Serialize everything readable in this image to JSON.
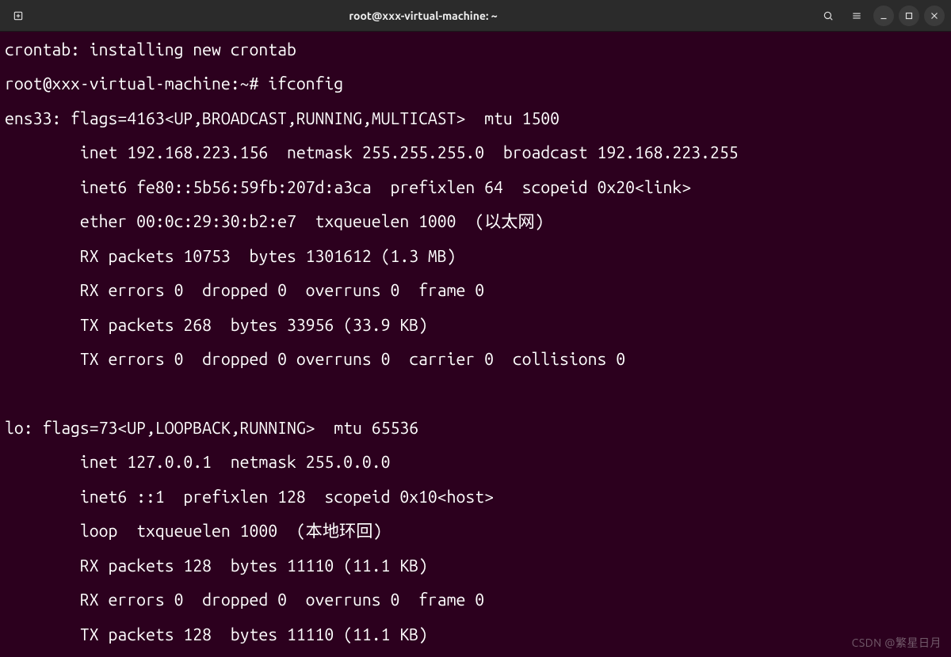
{
  "titlebar": {
    "title": "root@xxx-virtual-machine: ~"
  },
  "terminal": {
    "lines": [
      "crontab: installing new crontab",
      "root@xxx-virtual-machine:~# ifconfig",
      "ens33: flags=4163<UP,BROADCAST,RUNNING,MULTICAST>  mtu 1500",
      "        inet 192.168.223.156  netmask 255.255.255.0  broadcast 192.168.223.255",
      "        inet6 fe80::5b56:59fb:207d:a3ca  prefixlen 64  scopeid 0x20<link>",
      "        ether 00:0c:29:30:b2:e7  txqueuelen 1000  (以太网)",
      "        RX packets 10753  bytes 1301612 (1.3 MB)",
      "        RX errors 0  dropped 0  overruns 0  frame 0",
      "        TX packets 268  bytes 33956 (33.9 KB)",
      "        TX errors 0  dropped 0 overruns 0  carrier 0  collisions 0",
      "",
      "lo: flags=73<UP,LOOPBACK,RUNNING>  mtu 65536",
      "        inet 127.0.0.1  netmask 255.0.0.0",
      "        inet6 ::1  prefixlen 128  scopeid 0x10<host>",
      "        loop  txqueuelen 1000  (本地环回)",
      "        RX packets 128  bytes 11110 (11.1 KB)",
      "        RX errors 0  dropped 0  overruns 0  frame 0",
      "        TX packets 128  bytes 11110 (11.1 KB)"
    ]
  },
  "watermark": "CSDN @繁星日月"
}
